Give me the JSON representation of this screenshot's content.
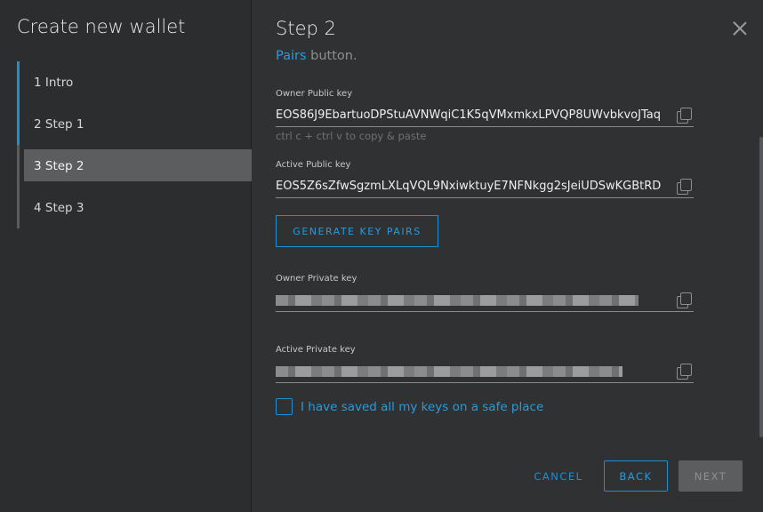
{
  "sidebar": {
    "title": "Create new wallet",
    "steps": [
      {
        "label": "1  Intro"
      },
      {
        "label": "2  Step 1"
      },
      {
        "label": "3  Step 2"
      },
      {
        "label": "4  Step 3"
      }
    ]
  },
  "main": {
    "title": "Step 2",
    "intro_link": "Pairs",
    "intro_rest": " button.",
    "owner_public": {
      "label": "Owner Public key",
      "value": "EOS86J9EbartuoDPStuAVNWqiC1K5qVMxmkxLPVQP8UWvbkvoJTaq"
    },
    "hint": "ctrl c + ctrl v to copy & paste",
    "active_public": {
      "label": "Active Public key",
      "value": "EOS5Z6sZfwSgzmLXLqVQL9NxiwktuyE7NFNkgg2sJeiUDSwKGBtRD"
    },
    "generate_label": "GENERATE KEY PAIRS",
    "owner_private": {
      "label": "Owner Private key"
    },
    "active_private": {
      "label": "Active Private key"
    },
    "checkbox_label": "I have saved all my keys on a safe place"
  },
  "footer": {
    "cancel": "CANCEL",
    "back": "BACK",
    "next": "NEXT"
  },
  "colors": {
    "accent": "#1e8fcf",
    "background": "#2f3133",
    "sidebar": "#2b2d2f"
  }
}
